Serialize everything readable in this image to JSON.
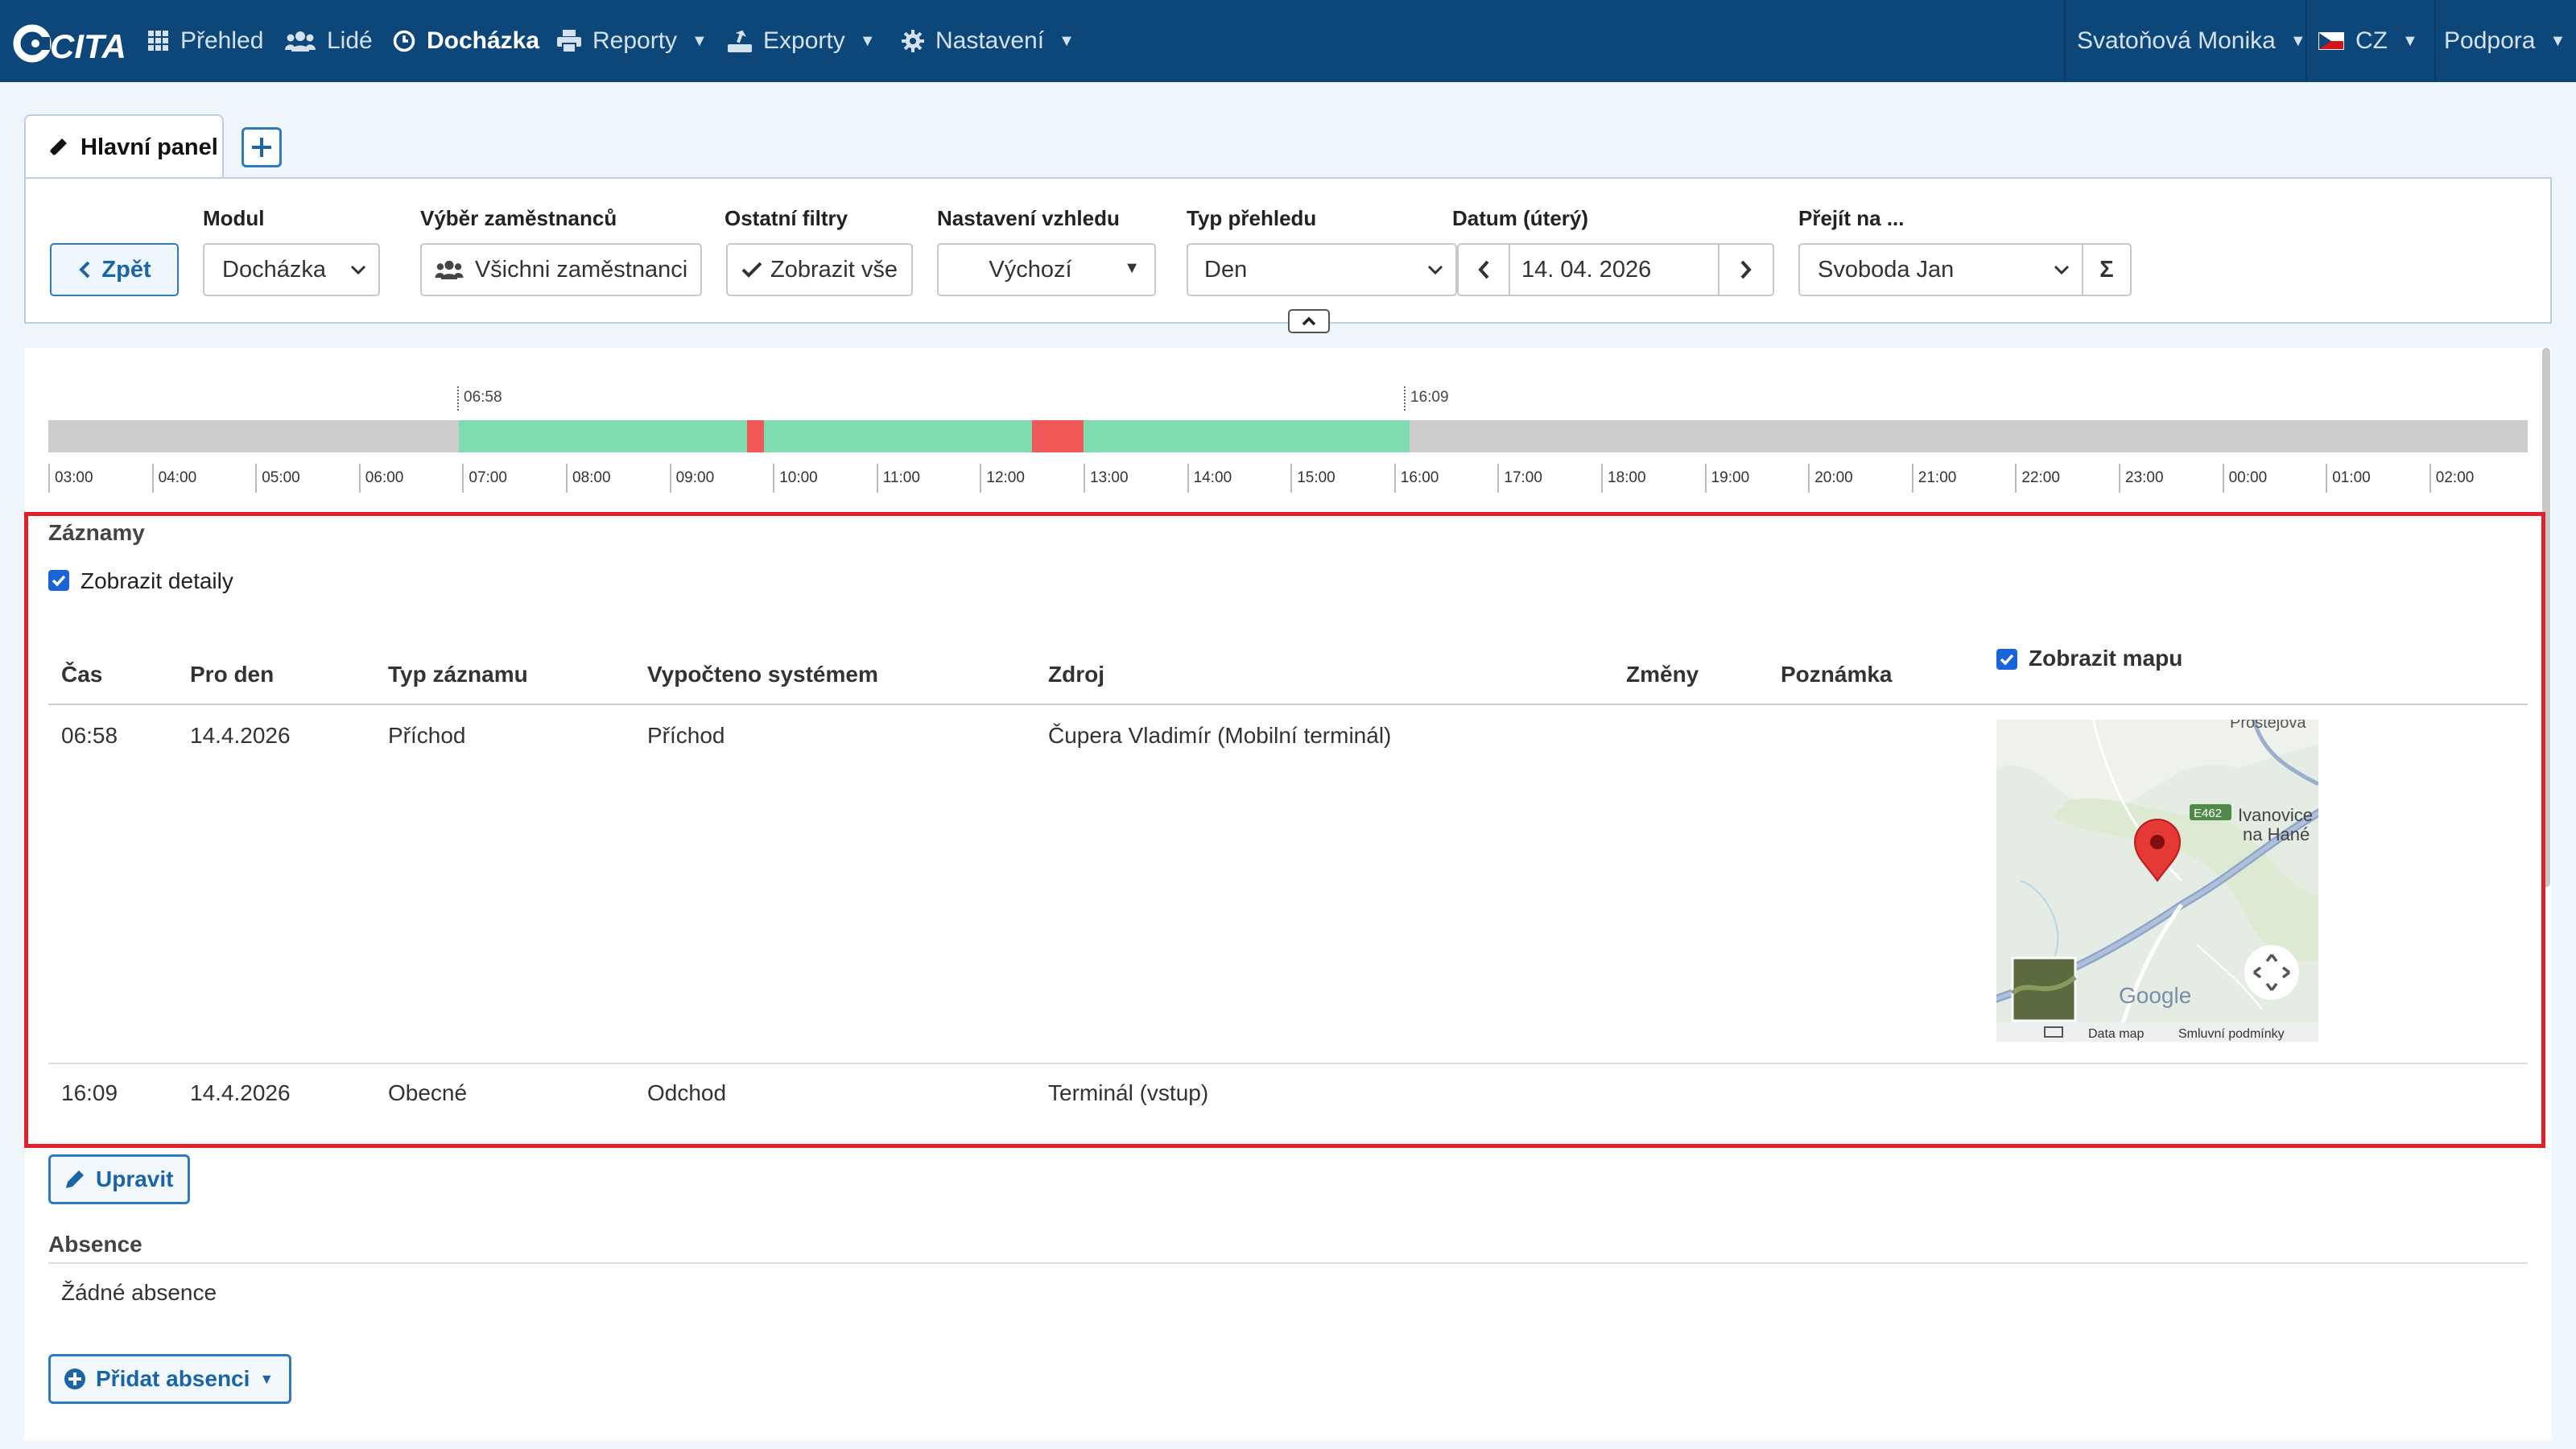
{
  "brand": {
    "logo_text": "CITA"
  },
  "nav": {
    "items": [
      {
        "label": "Přehled",
        "icon": "grid-icon"
      },
      {
        "label": "Lidé",
        "icon": "users-icon"
      },
      {
        "label": "Docházka",
        "icon": "clock-icon",
        "active": true
      },
      {
        "label": "Reporty",
        "icon": "printer-icon",
        "dropdown": true
      },
      {
        "label": "Exporty",
        "icon": "export-icon",
        "dropdown": true
      },
      {
        "label": "Nastavení",
        "icon": "gear-icon",
        "dropdown": true
      }
    ],
    "user": "Svatoňová Monika",
    "language": "CZ",
    "support": "Podpora"
  },
  "tabs": {
    "main": "Hlavní panel"
  },
  "filters": {
    "back_label": "Zpět",
    "module": {
      "label": "Modul",
      "value": "Docházka"
    },
    "employees": {
      "label": "Výběr zaměstnanců",
      "value": "Všichni zaměstnanci"
    },
    "other": {
      "label": "Ostatní filtry",
      "value": "Zobrazit vše"
    },
    "appearance": {
      "label": "Nastavení vzhledu",
      "value": "Výchozí"
    },
    "view_type": {
      "label": "Typ přehledu",
      "value": "Den"
    },
    "date": {
      "label": "Datum (úterý)",
      "value": "14. 04. 2026"
    },
    "goto": {
      "label": "Přejít na ...",
      "value": "Svoboda Jan",
      "sum_symbol": "Σ"
    }
  },
  "timeline": {
    "start_marker": "06:58",
    "end_marker": "16:09",
    "ticks": [
      "03:00",
      "04:00",
      "05:00",
      "06:00",
      "07:00",
      "08:00",
      "09:00",
      "10:00",
      "11:00",
      "12:00",
      "13:00",
      "14:00",
      "15:00",
      "16:00",
      "17:00",
      "18:00",
      "19:00",
      "20:00",
      "21:00",
      "22:00",
      "23:00",
      "00:00",
      "01:00",
      "02:00"
    ],
    "colors": {
      "work": "#7edcb0",
      "break": "#f25a5a",
      "empty": "#cccccc"
    }
  },
  "records": {
    "title": "Záznamy",
    "show_details": "Zobrazit detaily",
    "show_map": "Zobrazit mapu",
    "columns": {
      "time": "Čas",
      "day": "Pro den",
      "type": "Typ záznamu",
      "computed": "Vypočteno systémem",
      "source": "Zdroj",
      "changes": "Změny",
      "note": "Poznámka"
    },
    "rows": [
      {
        "time": "06:58",
        "day": "14.4.2026",
        "type": "Příchod",
        "computed": "Příchod",
        "source": "Čupera Vladimír (Mobilní terminál)"
      },
      {
        "time": "16:09",
        "day": "14.4.2026",
        "type": "Obecné",
        "computed": "Odchod",
        "source": "Terminál (vstup)"
      }
    ],
    "map": {
      "place_top": "Prostějova",
      "place_1": "Ivanovice",
      "place_2": "na Hané",
      "road": "E462",
      "brand": "Google",
      "data": "Data map",
      "terms": "Smluvní podmínky"
    },
    "edit_label": "Upravit"
  },
  "absence": {
    "title": "Absence",
    "empty": "Žádné absence",
    "add_label": "Přidat absenci"
  }
}
